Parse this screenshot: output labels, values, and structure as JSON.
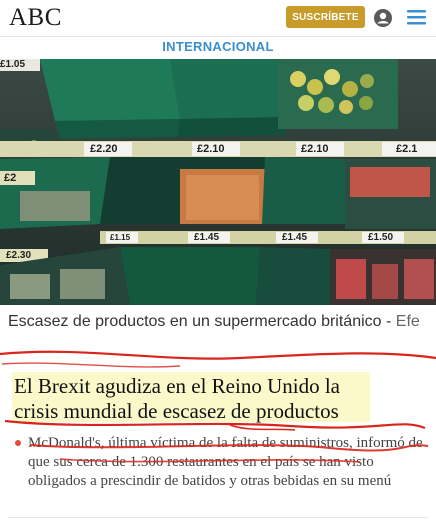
{
  "header": {
    "logo": "ABC",
    "subscribe_label": "SUSCRÍBETE"
  },
  "section": {
    "label": "INTERNACIONAL"
  },
  "photo": {
    "price_tags": [
      "£1.05",
      "£2.20",
      "£2.10",
      "£2.10",
      "£2.1",
      "£2",
      "£1.15",
      "£1.45",
      "£1.45",
      "£1.50",
      "£2.30"
    ]
  },
  "caption": {
    "text": "Escasez de productos en un supermercado británico - ",
    "credit": "Efe"
  },
  "article": {
    "headline_line1": "El Brexit agudiza en el Reino Unido la",
    "headline_line2": "crisis mundial de escasez de productos",
    "summary": "McDonald's, última víctima de la falta de suministros, informó de que sus cerca de 1.300 restaurantes en el país se han visto obligados a prescindir de batidos y otras bebidas en su menú"
  },
  "colors": {
    "accent_blue": "#3a8fd1",
    "subscribe_gold": "#c89b2a",
    "annotation_red": "#d9261c",
    "bullet_red": "#e34b3b"
  }
}
